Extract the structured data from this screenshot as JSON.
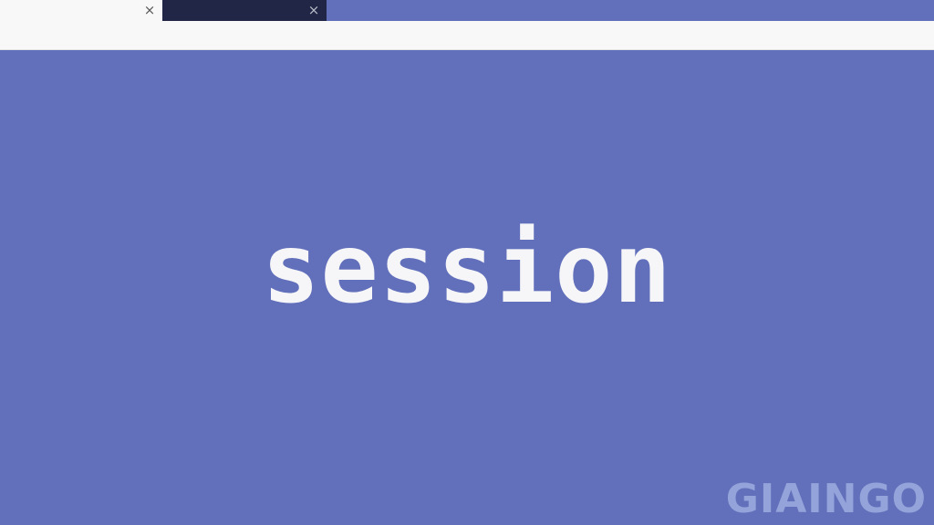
{
  "tabs": [
    {
      "close_glyph": "×"
    },
    {
      "close_glyph": "×"
    }
  ],
  "slide": {
    "word": "session"
  },
  "watermark": {
    "text": "GIAINGO"
  },
  "colors": {
    "background": "#6270bc",
    "active_tab": "#222646",
    "inactive_tab": "#f8f8f8",
    "text": "#f6f6f8"
  }
}
